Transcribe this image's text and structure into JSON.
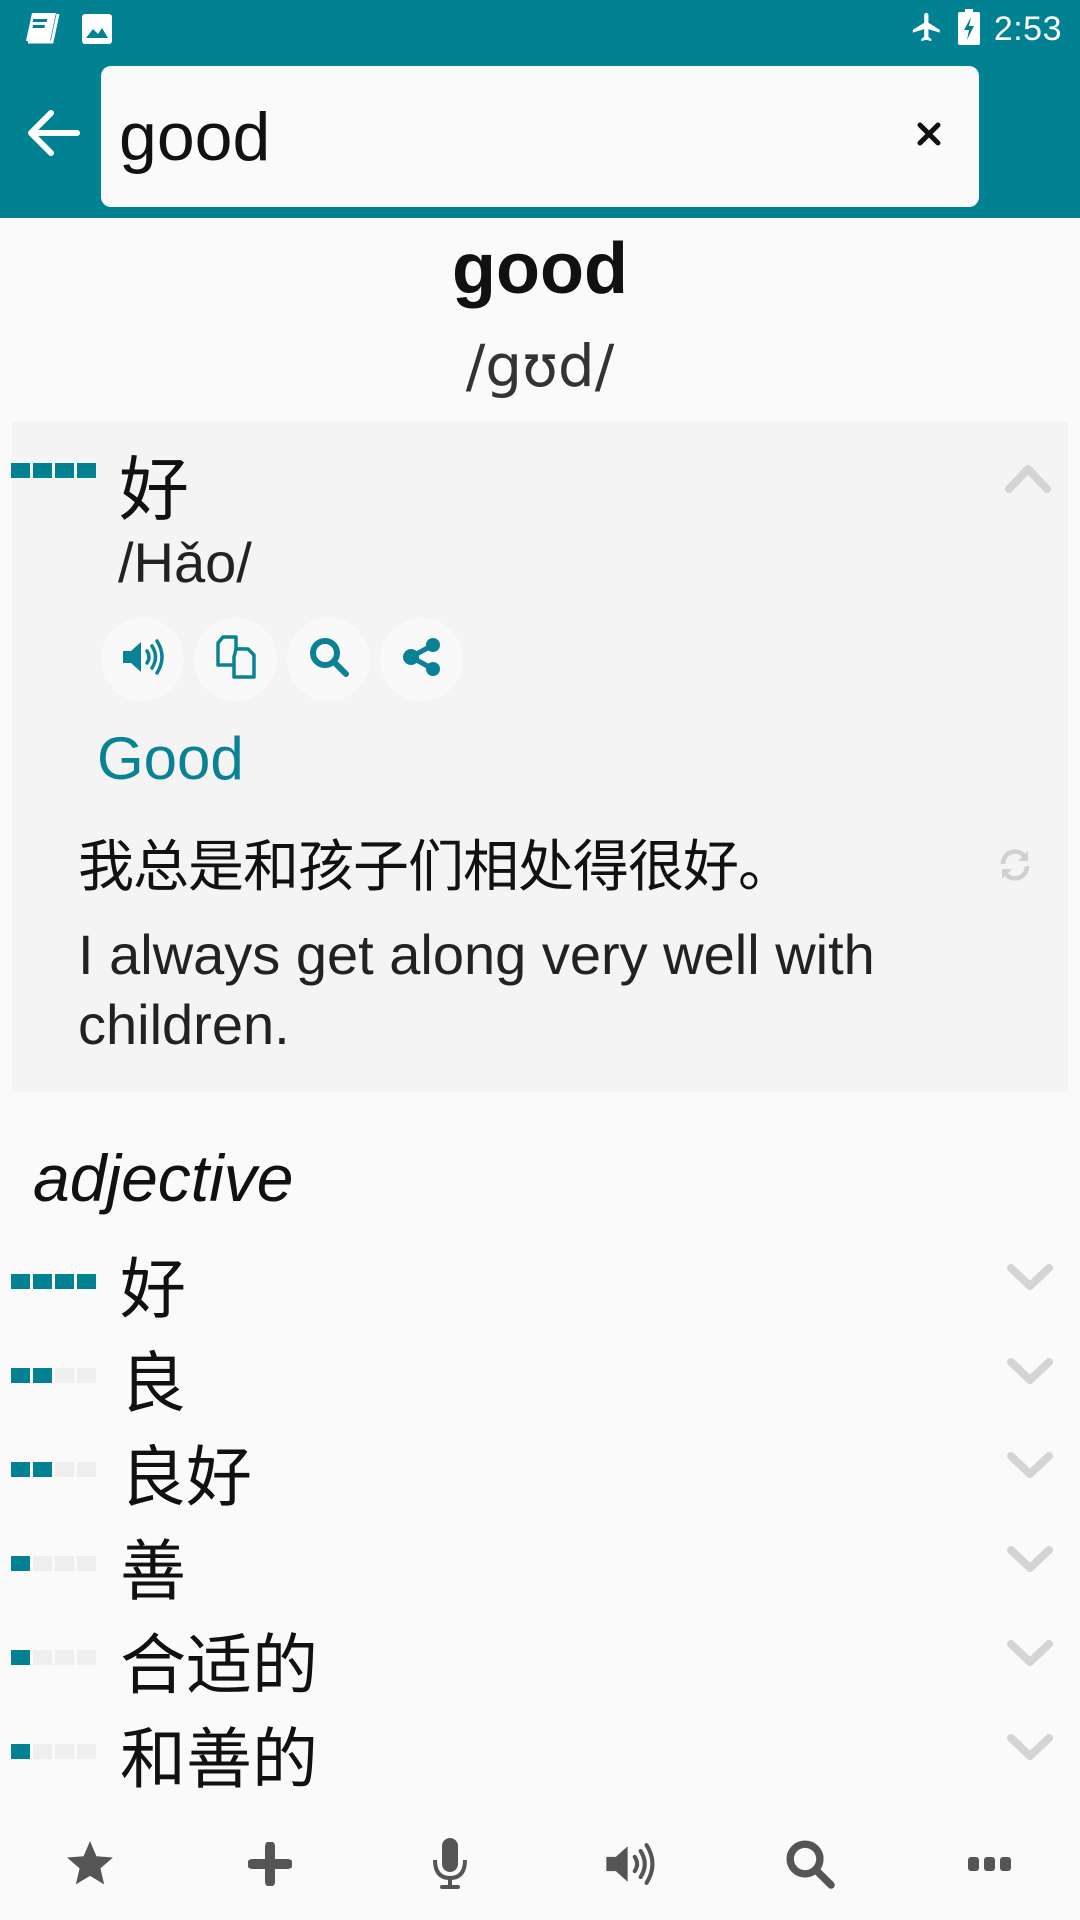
{
  "status_bar": {
    "left_icons": [
      "dictionary-app-icon",
      "image-icon"
    ],
    "right_icons": [
      "airplane-mode-icon",
      "battery-charging-icon"
    ],
    "time": "2:53"
  },
  "search": {
    "value": "good",
    "placeholder": "",
    "back_icon": "arrow-left-icon",
    "clear_icon": "close-icon"
  },
  "entry": {
    "headword": "good",
    "phonetic": "/gʊd/"
  },
  "expanded_translation": {
    "chinese": "好",
    "pinyin": "/Hǎo/",
    "frequency": 4,
    "frequency_max": 4,
    "actions": [
      {
        "name": "speak",
        "icon": "speaker-icon"
      },
      {
        "name": "copy",
        "icon": "copy-icon"
      },
      {
        "name": "search",
        "icon": "search-icon"
      },
      {
        "name": "share",
        "icon": "share-icon"
      }
    ],
    "meaning": "Good",
    "example_chinese": "我总是和孩子们相处得很好。",
    "example_english": "I always get along very well with children."
  },
  "part_of_speech": "adjective",
  "translations": [
    {
      "chinese": "好",
      "frequency": 4
    },
    {
      "chinese": "良",
      "frequency": 2
    },
    {
      "chinese": "良好",
      "frequency": 2
    },
    {
      "chinese": "善",
      "frequency": 1
    },
    {
      "chinese": "合适的",
      "frequency": 1
    },
    {
      "chinese": "和善的",
      "frequency": 1
    }
  ],
  "bottom_nav": [
    {
      "name": "favorites",
      "icon": "star-icon"
    },
    {
      "name": "add",
      "icon": "plus-icon"
    },
    {
      "name": "voice-input",
      "icon": "microphone-icon"
    },
    {
      "name": "pronounce",
      "icon": "speaker-icon"
    },
    {
      "name": "search",
      "icon": "search-icon"
    },
    {
      "name": "more",
      "icon": "more-icon"
    }
  ],
  "colors": {
    "primary": "#028193",
    "background": "#fafafa",
    "card": "#f4f4f4",
    "icon_grey": "#555555",
    "chevron_grey": "#d4d4d4"
  }
}
